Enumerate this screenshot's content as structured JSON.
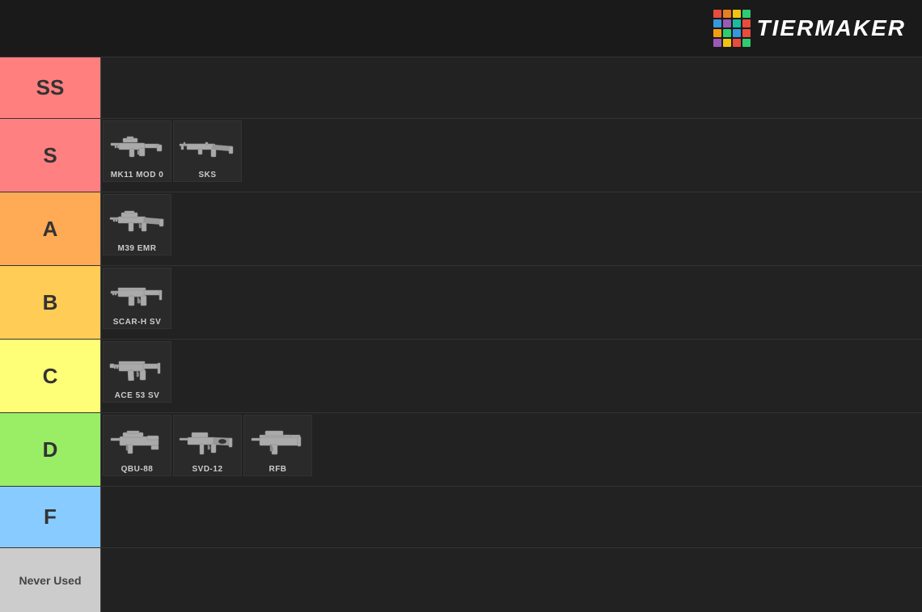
{
  "header": {
    "title": "TierMaker",
    "logo_alt": "TierMaker Logo"
  },
  "logo": {
    "colors": [
      "#e74c3c",
      "#e67e22",
      "#f1c40f",
      "#2ecc71",
      "#3498db",
      "#9b59b6",
      "#1abc9c",
      "#e74c3c",
      "#f39c12",
      "#2ecc71",
      "#3498db",
      "#e74c3c",
      "#9b59b6",
      "#f1c40f",
      "#e74c3c",
      "#2ecc71"
    ]
  },
  "tiers": [
    {
      "id": "ss",
      "label": "SS",
      "color": "#ff7f7f",
      "weapons": []
    },
    {
      "id": "s",
      "label": "S",
      "color": "#ff8080",
      "weapons": [
        {
          "name": "MK11 MOD 0"
        },
        {
          "name": "SKS"
        }
      ]
    },
    {
      "id": "a",
      "label": "A",
      "color": "#ffaa55",
      "weapons": [
        {
          "name": "M39 EMR"
        }
      ]
    },
    {
      "id": "b",
      "label": "B",
      "color": "#ffcc55",
      "weapons": [
        {
          "name": "SCAR-H SV"
        }
      ]
    },
    {
      "id": "c",
      "label": "C",
      "color": "#ffff77",
      "weapons": [
        {
          "name": "ACE 53 SV"
        }
      ]
    },
    {
      "id": "d",
      "label": "D",
      "color": "#99ee66",
      "weapons": [
        {
          "name": "QBU-88"
        },
        {
          "name": "SVD-12"
        },
        {
          "name": "RFB"
        }
      ]
    },
    {
      "id": "f",
      "label": "F",
      "color": "#88ccff",
      "weapons": []
    },
    {
      "id": "never",
      "label": "Never Used",
      "color": "#cccccc",
      "weapons": []
    }
  ]
}
